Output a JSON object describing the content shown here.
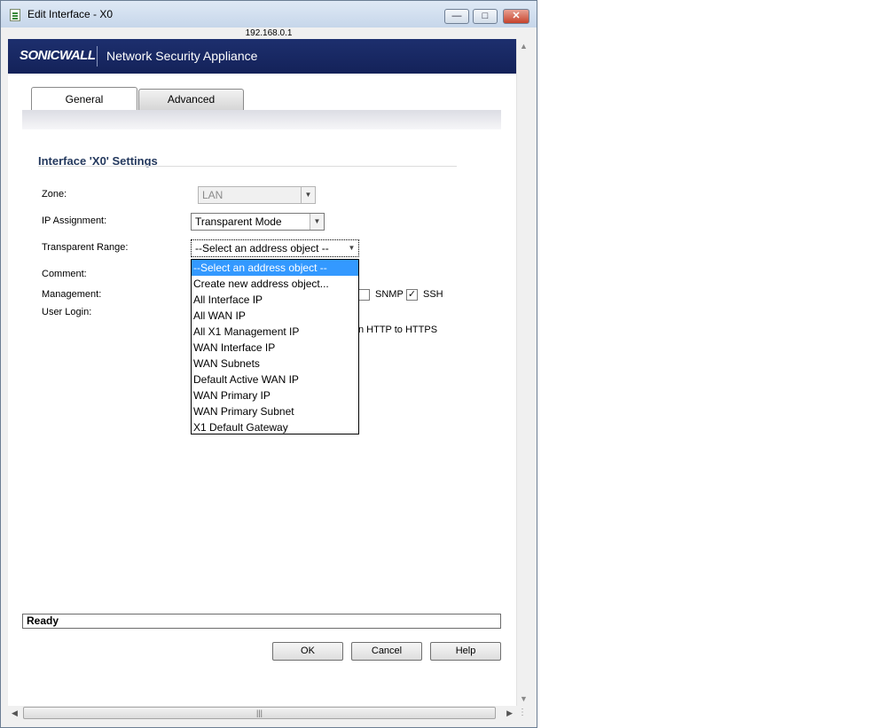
{
  "window": {
    "title": "Edit Interface - X0",
    "address": "192.168.0.1"
  },
  "banner": {
    "logo": "SONICWALL",
    "product": "Network Security Appliance"
  },
  "tabs": [
    {
      "label": "General"
    },
    {
      "label": "Advanced"
    }
  ],
  "section": {
    "title": "Interface 'X0' Settings"
  },
  "form": {
    "zone": {
      "label": "Zone:",
      "value": "LAN"
    },
    "ip_assignment": {
      "label": "IP Assignment:",
      "value": "Transparent Mode"
    },
    "transparent_range": {
      "label": "Transparent Range:",
      "value": "--Select an address object --"
    },
    "comment": {
      "label": "Comment:"
    },
    "management": {
      "label": "Management:",
      "snmp": {
        "label": "SNMP",
        "checked": false
      },
      "ssh": {
        "label": "SSH",
        "checked": true
      }
    },
    "user_login": {
      "label": "User Login:",
      "redirect_partial": "n HTTP to HTTPS"
    }
  },
  "dropdown": {
    "options": [
      "--Select an address object --",
      "Create new address object...",
      "All Interface IP",
      "All WAN IP",
      "All X1 Management IP",
      "WAN Interface IP",
      "WAN Subnets",
      "Default Active WAN IP",
      "WAN Primary IP",
      "WAN Primary Subnet",
      "X1 Default Gateway"
    ],
    "selected_index": 0
  },
  "status": {
    "text": "Ready"
  },
  "buttons": {
    "ok": "OK",
    "cancel": "Cancel",
    "help": "Help"
  },
  "icons": {
    "minimize": "minimize-icon",
    "maximize": "maximize-icon",
    "close": "close-icon",
    "dropdown": "chevron-down-icon",
    "check": "checkmark-icon"
  },
  "colors": {
    "banner": "#1d2f6e",
    "section_title": "#24395e",
    "selection": "#3399ff"
  }
}
